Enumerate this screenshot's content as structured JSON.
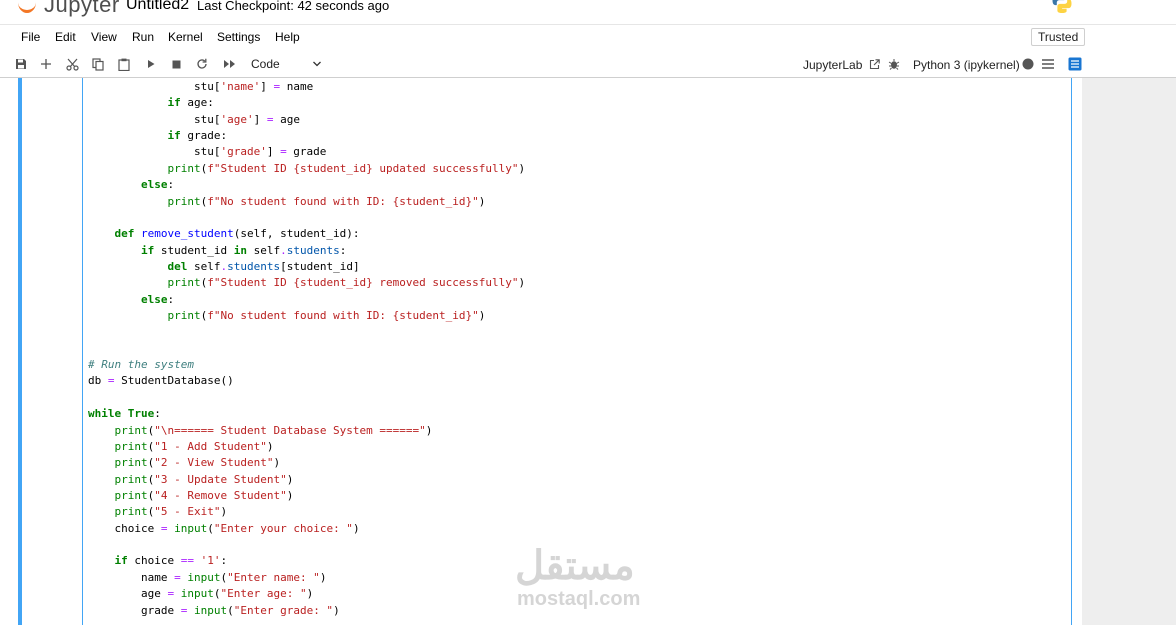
{
  "header": {
    "logo_text": "Jupyter",
    "notebook_name": "Untitled2",
    "checkpoint": "Last Checkpoint: 42 seconds ago"
  },
  "menu": {
    "items": [
      "File",
      "Edit",
      "View",
      "Run",
      "Kernel",
      "Settings",
      "Help"
    ],
    "trusted": "Trusted"
  },
  "toolbar": {
    "cell_type": "Code",
    "jupyterlab_link": "JupyterLab",
    "kernel": "Python 3 (ipykernel)",
    "icons": [
      "save-icon",
      "add-cell-icon",
      "cut-icon",
      "copy-icon",
      "paste-icon",
      "run-icon",
      "stop-icon",
      "restart-icon",
      "fast-forward-icon",
      "chevron-down-icon",
      "external-link-icon",
      "debugger-icon",
      "kernel-status-icon",
      "menu-icon",
      "property-inspector-icon"
    ]
  },
  "colors": {
    "accent": "#42a5f5",
    "keyword": "#008000",
    "string": "#ba2121",
    "comment": "#408080",
    "operator": "#aa22ff",
    "jupyter_orange": "#f37726"
  },
  "code_lines": [
    "                stu['name'] = name",
    "            if age:",
    "                stu['age'] = age",
    "            if grade:",
    "                stu['grade'] = grade",
    "            print(f\"Student ID {student_id} updated successfully\")",
    "        else:",
    "            print(f\"No student found with ID: {student_id}\")",
    "",
    "    def remove_student(self, student_id):",
    "        if student_id in self.students:",
    "            del self.students[student_id]",
    "            print(f\"Student ID {student_id} removed successfully\")",
    "        else:",
    "            print(f\"No student found with ID: {student_id}\")",
    "",
    "",
    "# Run the system",
    "db = StudentDatabase()",
    "",
    "while True:",
    "    print(\"\\n====== Student Database System ======\")",
    "    print(\"1 - Add Student\")",
    "    print(\"2 - View Student\")",
    "    print(\"3 - Update Student\")",
    "    print(\"4 - Remove Student\")",
    "    print(\"5 - Exit\")",
    "    choice = input(\"Enter your choice: \")",
    "",
    "    if choice == '1':",
    "        name = input(\"Enter name: \")",
    "        age = input(\"Enter age: \")",
    "        grade = input(\"Enter grade: \")"
  ],
  "watermark": {
    "arabic": "مستقل",
    "latin": "mostaql.com"
  }
}
